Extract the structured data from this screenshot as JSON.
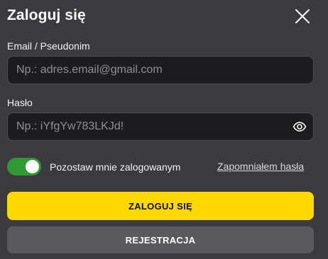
{
  "dialog": {
    "title": "Zaloguj się"
  },
  "email": {
    "label": "Email / Pseudonim",
    "value": "",
    "placeholder": "Np.: adres.email@gmail.com"
  },
  "password": {
    "label": "Hasło",
    "value": "",
    "placeholder": "Np.: iYfgYw783LKJd!"
  },
  "remember": {
    "label": "Pozostaw mnie zalogowanym",
    "checked": true
  },
  "forgot_link": "Zapomniałem hasła",
  "buttons": {
    "login": "ZALOGUJ SIĘ",
    "register": "REJESTRACJA"
  },
  "icons": {
    "close": "close-icon",
    "password_visibility": "eye-icon"
  },
  "colors": {
    "background": "#3b3b3f",
    "input_background": "#1d1d20",
    "accent_yellow": "#ffd800",
    "toggle_on": "#2f9a34",
    "secondary_button": "#5a5a5e"
  }
}
